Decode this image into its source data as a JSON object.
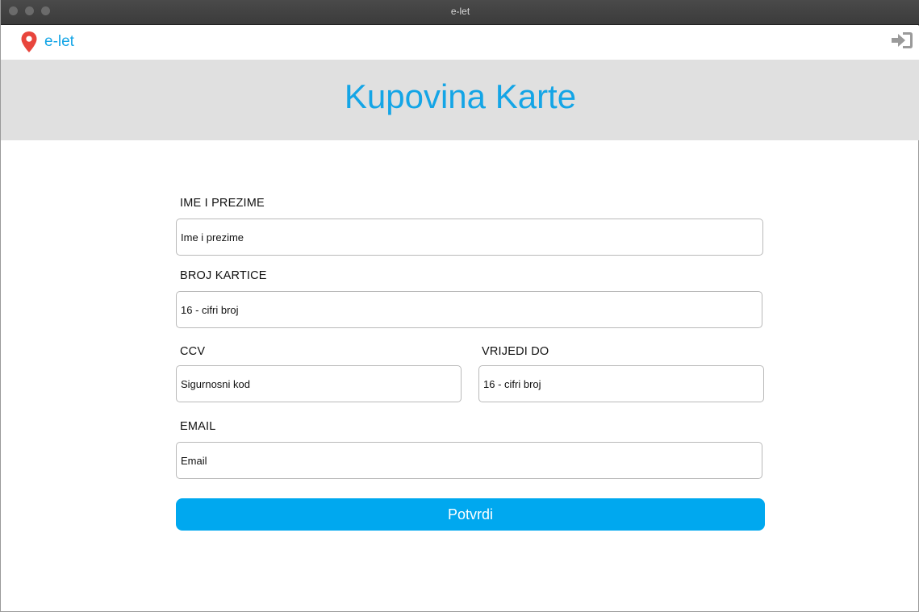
{
  "window": {
    "title": "e-let"
  },
  "navbar": {
    "brand": "e-let",
    "brand_icon": "map-pin-icon",
    "login_icon": "sign-in-icon"
  },
  "header": {
    "title": "Kupovina Karte"
  },
  "form": {
    "full_name": {
      "label": "IME I PREZIME",
      "placeholder": "Ime i prezime",
      "value": ""
    },
    "card_number": {
      "label": "BROJ KARTICE",
      "placeholder": "16 - cifri broj",
      "value": ""
    },
    "ccv": {
      "label": "CCV",
      "placeholder": "Sigurnosni kod",
      "value": ""
    },
    "valid_until": {
      "label": "VRIJEDI DO",
      "placeholder": "16 - cifri broj",
      "value": ""
    },
    "email": {
      "label": "EMAIL",
      "placeholder": "Email",
      "value": ""
    },
    "submit_label": "Potvrdi"
  },
  "colors": {
    "accent": "#14a5e6",
    "button": "#00a8ef",
    "pin": "#e8453c",
    "header_bg": "#e0e0e0"
  }
}
